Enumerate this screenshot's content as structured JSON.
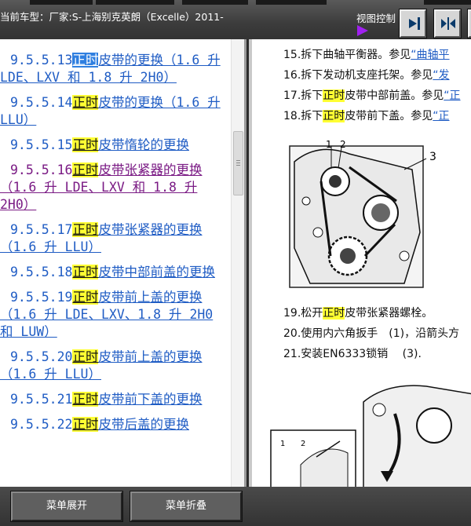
{
  "header": {
    "car_label": "当前车型：厂家:S-上海别克英朗（Excelle）2011-",
    "view_label": "视图控制",
    "buttons": [
      {
        "name": "expand-right-pane-button",
        "icon": "arrow-right-bar-icon"
      },
      {
        "name": "split-view-button",
        "icon": "double-arrow-split-icon"
      }
    ]
  },
  "toc": [
    {
      "num": "9.5.5.13 ",
      "hl": "正时",
      "rest": "皮带的更换（1.6 升 LDE、LXV 和 1.8 升 2H0）",
      "selected": true,
      "visited": false
    },
    {
      "num": "9.5.5.14 ",
      "hl": "正时",
      "rest": "皮带的更换（1.6 升 LLU）",
      "selected": false,
      "visited": false
    },
    {
      "num": "9.5.5.15 ",
      "hl": "正时",
      "rest": "皮带惰轮的更换",
      "selected": false,
      "visited": false
    },
    {
      "num": "9.5.5.16 ",
      "hl": "正时",
      "rest": "皮带张紧器的更换（1.6 升 LDE、LXV 和 1.8 升 2H0）",
      "selected": false,
      "visited": true
    },
    {
      "num": "9.5.5.17 ",
      "hl": "正时",
      "rest": "皮带张紧器的更换（1.6 升 LLU）",
      "selected": false,
      "visited": false
    },
    {
      "num": "9.5.5.18 ",
      "hl": "正时",
      "rest": "皮带中部前盖的更换",
      "selected": false,
      "visited": false
    },
    {
      "num": "9.5.5.19 ",
      "hl": "正时",
      "rest": "皮带前上盖的更换（1.6 升 LDE、LXV、1.8 升 2H0 和 LUW）",
      "selected": false,
      "visited": false
    },
    {
      "num": "9.5.5.20 ",
      "hl": "正时",
      "rest": "皮带前上盖的更换 （1.6 升 LLU）",
      "selected": false,
      "visited": false
    },
    {
      "num": "9.5.5.21 ",
      "hl": "正时",
      "rest": "皮带前下盖的更换",
      "selected": false,
      "visited": false
    },
    {
      "num": "9.5.5.22 ",
      "hl": "正时",
      "rest": "皮带后盖的更换",
      "selected": false,
      "visited": false
    }
  ],
  "steps": [
    {
      "text": "15.拆下曲轴平衡器。参见",
      "hl": "",
      "after": "",
      "ref": "“曲轴平"
    },
    {
      "text": "16.拆下发动机支座托架。参见",
      "hl": "",
      "after": "",
      "ref": "“发"
    },
    {
      "text": "17.拆下",
      "hl": "正时",
      "after": "皮带中部前盖。参见",
      "ref": "“正"
    },
    {
      "text": "18.拆下",
      "hl": "正时",
      "after": "皮带前下盖。参见",
      "ref": "“正"
    }
  ],
  "steps2": [
    {
      "text": "19.松开",
      "hl": "正时",
      "after": "皮带张紧器螺栓。"
    },
    {
      "text": "20.使用内六角扳手　(1)，沿箭头方",
      "hl": "",
      "after": ""
    },
    {
      "text": "21.安装EN6333锁销　 (3).",
      "hl": "",
      "after": ""
    }
  ],
  "figure1": {
    "callouts": [
      "1",
      "2",
      "3"
    ]
  },
  "figure2": {
    "callouts": [
      "1",
      "2"
    ]
  },
  "bottom": {
    "expand_label": "菜单展开",
    "collapse_label": "菜单折叠"
  },
  "colors": {
    "link": "#1f5cc4",
    "visited": "#7a1a84",
    "highlight": "#ffff33",
    "selected": "#2f7fe0",
    "accent": "#a020f0"
  }
}
